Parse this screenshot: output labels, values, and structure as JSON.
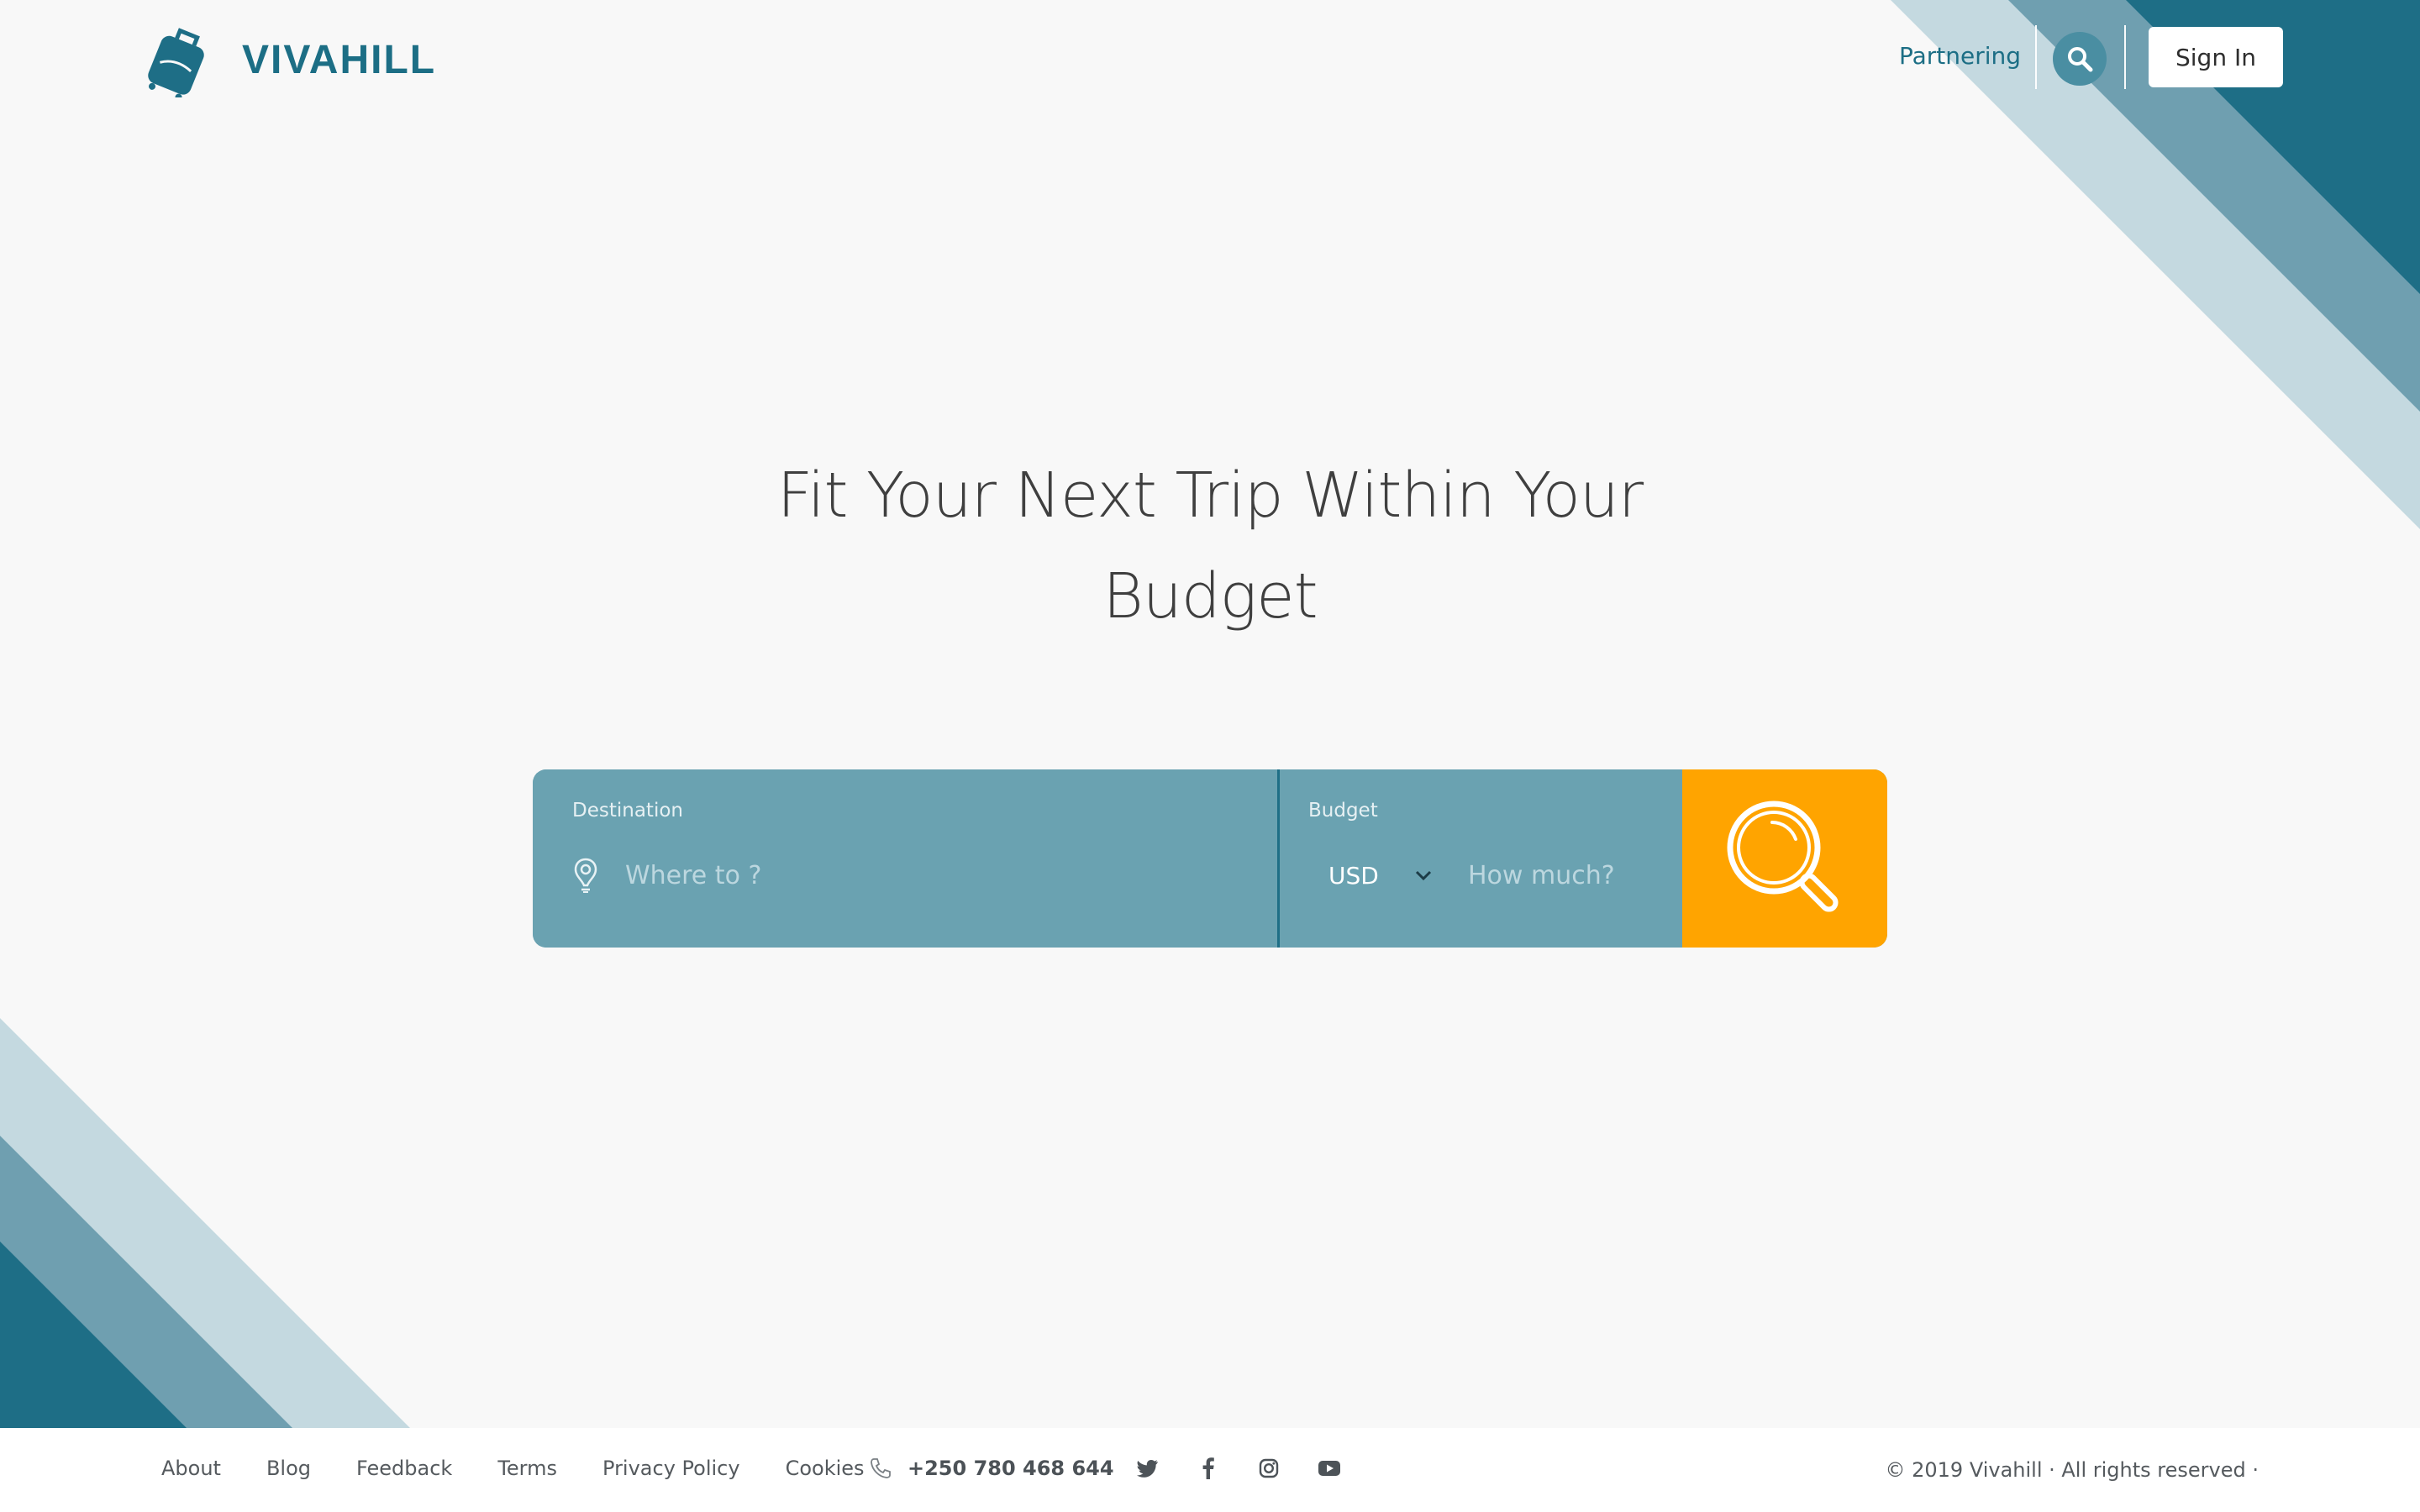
{
  "brand": {
    "name": "VIVAHILL",
    "color": "#1c6e85",
    "accent": "#ffa400"
  },
  "header": {
    "nav_link": "Partnering",
    "search_icon": "search-icon",
    "signin_label": "Sign In"
  },
  "hero": {
    "title": "Fit Your Next Trip Within Your Budget"
  },
  "search": {
    "destination_label": "Destination",
    "destination_placeholder": "Where to ?",
    "destination_icon": "map-pin-icon",
    "budget_label": "Budget",
    "currency": "USD",
    "budget_placeholder": "How much?",
    "submit_icon": "magnifier-icon"
  },
  "footer": {
    "links": [
      "About",
      "Blog",
      "Feedback",
      "Terms",
      "Privacy Policy",
      "Cookies"
    ],
    "phone": "+250 780 468 644",
    "phone_icon": "phone-icon",
    "socials": [
      "twitter-icon",
      "facebook-icon",
      "instagram-icon",
      "youtube-icon"
    ],
    "copyright": "© 2019 Vivahill · All rights reserved ·"
  }
}
